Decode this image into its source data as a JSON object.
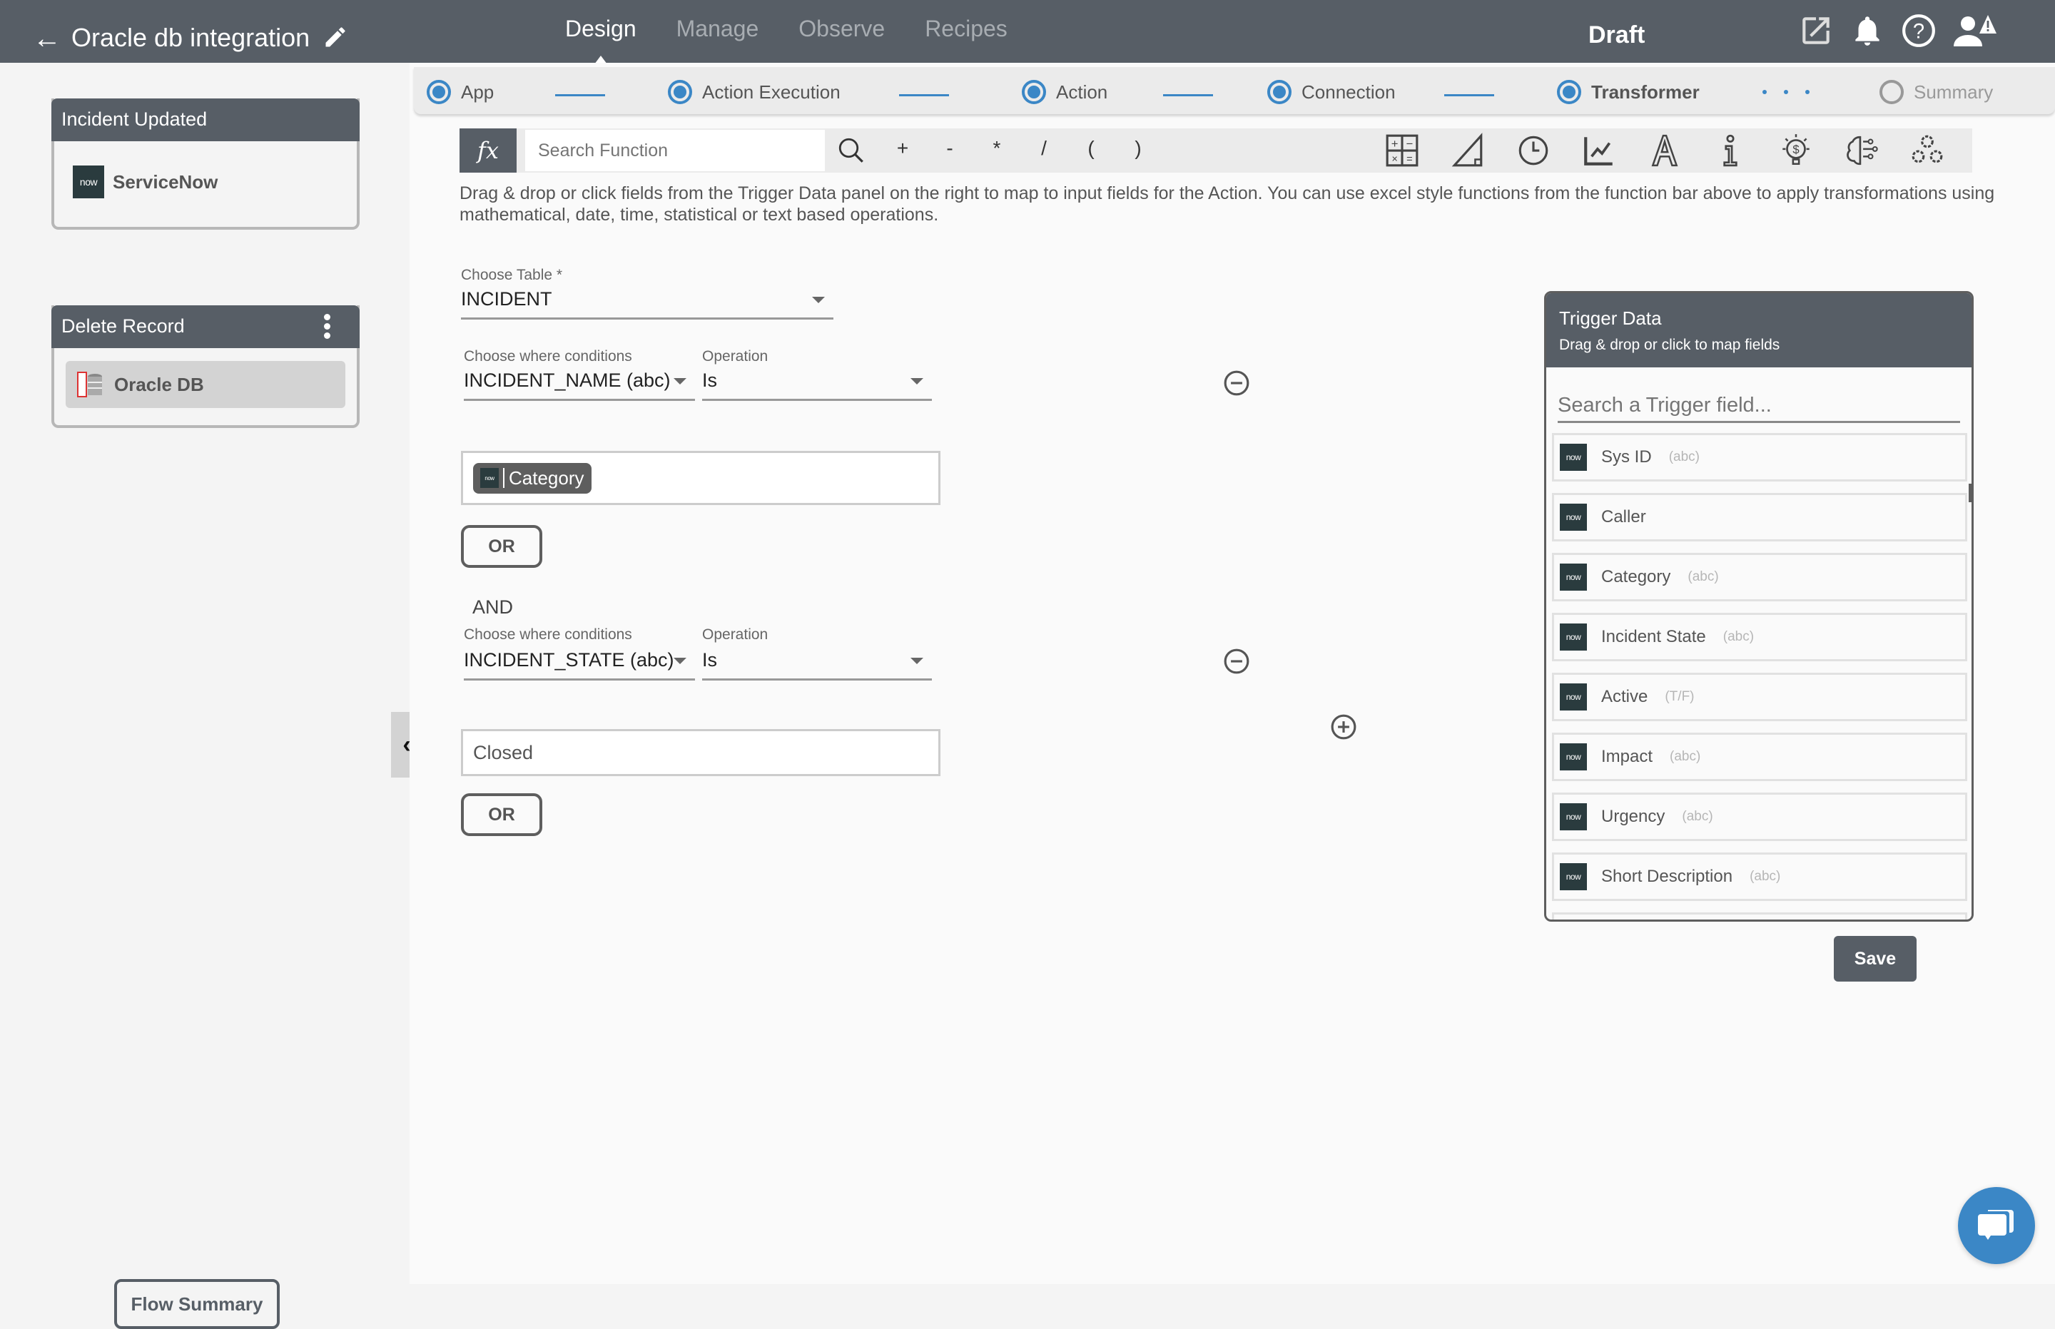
{
  "header": {
    "back_icon": "←",
    "title": "Oracle db integration",
    "nav_tabs": [
      {
        "label": "Design",
        "active": true
      },
      {
        "label": "Manage",
        "active": false
      },
      {
        "label": "Observe",
        "active": false
      },
      {
        "label": "Recipes",
        "active": false
      }
    ],
    "status": "Draft",
    "icons": [
      "external-link-icon",
      "bell-icon",
      "help-icon",
      "user-alert-icon"
    ]
  },
  "sidebar": {
    "trigger_card": {
      "title": "Incident Updated",
      "app": "ServiceNow",
      "logo_text": "now"
    },
    "action_card": {
      "title": "Delete Record",
      "app": "Oracle DB"
    },
    "flow_summary_label": "Flow Summary",
    "collapse_icon": "‹"
  },
  "stepper": {
    "steps": [
      {
        "label": "App",
        "state": "done"
      },
      {
        "label": "Action Execution",
        "state": "done"
      },
      {
        "label": "Action",
        "state": "done"
      },
      {
        "label": "Connection",
        "state": "done"
      },
      {
        "label": "Transformer",
        "state": "current"
      },
      {
        "label": "Summary",
        "state": "pending"
      }
    ]
  },
  "function_bar": {
    "fx_label": "fx",
    "search_placeholder": "Search Function",
    "operators": [
      "+",
      "-",
      "*",
      "/",
      "(",
      ")"
    ],
    "category_icons": [
      "math-icon",
      "trigonometry-icon",
      "clock-icon",
      "statistics-icon",
      "text-icon",
      "info-icon",
      "finance-icon",
      "ai-icon",
      "advanced-icon"
    ]
  },
  "help_text": "Drag & drop or click fields from the Trigger Data panel on the right to map to input fields for the Action. You can use excel style functions from the function bar above to apply transformations using mathematical, date, time, statistical or text based operations.",
  "form": {
    "table": {
      "label": "Choose Table *",
      "value": "INCIDENT"
    },
    "conditions": [
      {
        "where_label": "Choose where conditions",
        "where_value": "INCIDENT_NAME (abc)",
        "operation_label": "Operation",
        "operation_value": "Is",
        "value_chip": "Category",
        "value_text": null,
        "or_label": "OR"
      },
      {
        "connector": "AND",
        "where_label": "Choose where conditions",
        "where_value": "INCIDENT_STATE (abc)",
        "operation_label": "Operation",
        "operation_value": "Is",
        "value_chip": null,
        "value_text": "Closed",
        "or_label": "OR"
      }
    ]
  },
  "trigger_panel": {
    "title": "Trigger Data",
    "subtitle": "Drag & drop or click to map fields",
    "search_placeholder": "Search a Trigger field...",
    "fields": [
      {
        "name": "Sys ID",
        "type": "(abc)"
      },
      {
        "name": "Caller",
        "type": ""
      },
      {
        "name": "Category",
        "type": "(abc)"
      },
      {
        "name": "Incident State",
        "type": "(abc)"
      },
      {
        "name": "Active",
        "type": "(T/F)"
      },
      {
        "name": "Impact",
        "type": "(abc)"
      },
      {
        "name": "Urgency",
        "type": "(abc)"
      },
      {
        "name": "Short Description",
        "type": "(abc)"
      }
    ]
  },
  "save_label": "Save",
  "colors": {
    "header": "#575e66",
    "accent": "#3b87c6",
    "servicenow": "#2a3b3e"
  }
}
